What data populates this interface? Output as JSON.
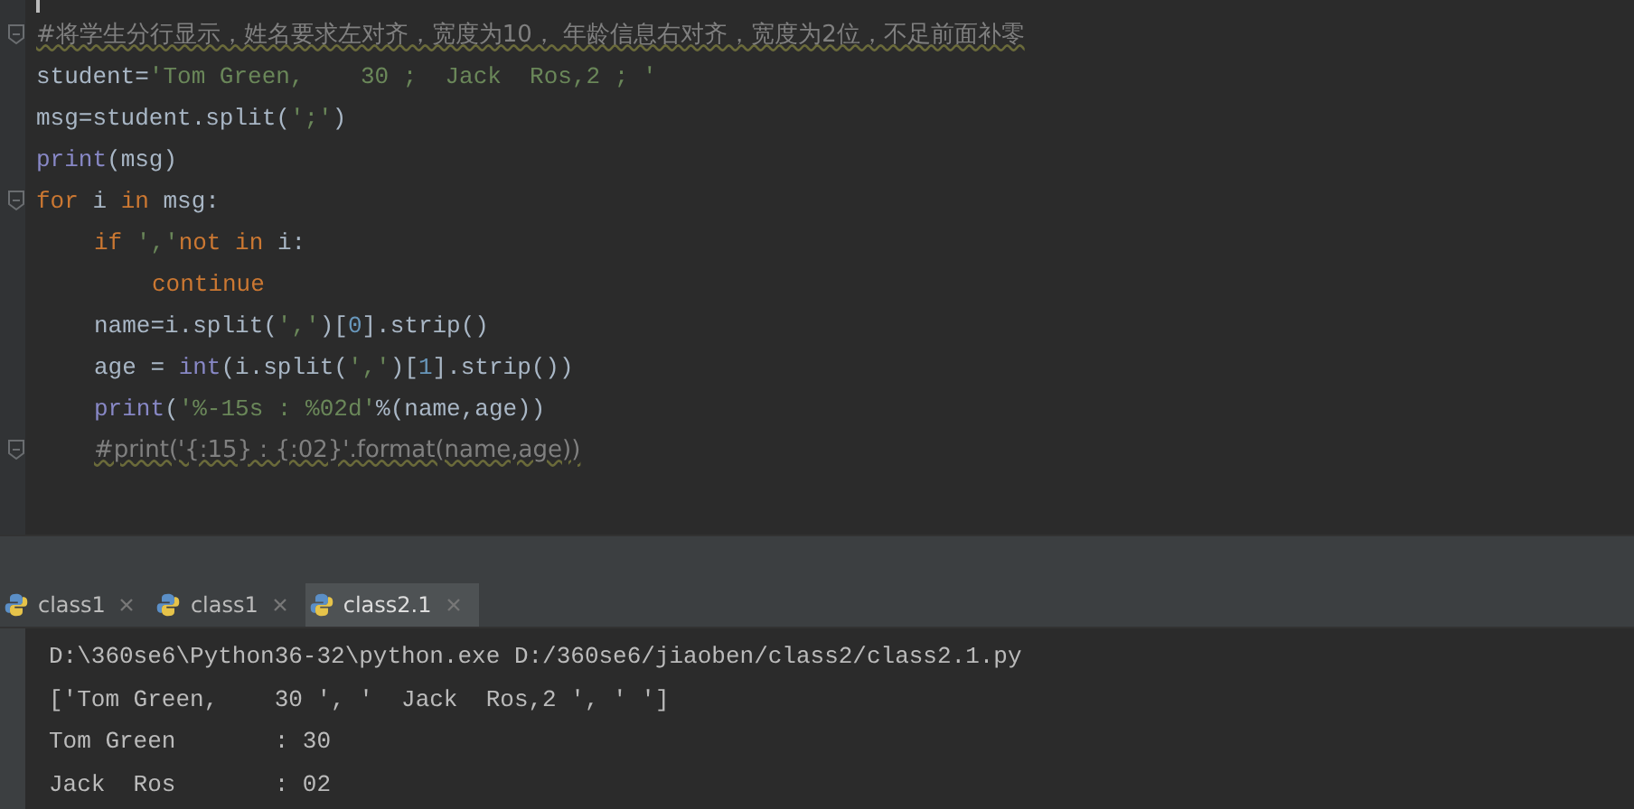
{
  "editor": {
    "lines": [
      {
        "fold_marker": true,
        "tokens": [
          {
            "kind": "comment",
            "text": "#将学生分行显示，姓名要求左对齐，宽度为10， 年龄信息右对齐，宽度为2位，不足前面补零"
          }
        ]
      },
      {
        "fold_marker": false,
        "tokens": [
          {
            "kind": "plain",
            "text": "student="
          },
          {
            "kind": "string",
            "text": "'Tom Green,    30 ;  Jack  Ros,2 ; '"
          }
        ]
      },
      {
        "fold_marker": false,
        "tokens": [
          {
            "kind": "plain",
            "text": "msg=student.split("
          },
          {
            "kind": "string",
            "text": "';'"
          },
          {
            "kind": "plain",
            "text": ")"
          }
        ]
      },
      {
        "fold_marker": false,
        "tokens": [
          {
            "kind": "builtin",
            "text": "print"
          },
          {
            "kind": "plain",
            "text": "(msg)"
          }
        ]
      },
      {
        "fold_marker": true,
        "tokens": [
          {
            "kind": "keyword",
            "text": "for"
          },
          {
            "kind": "plain",
            "text": " i "
          },
          {
            "kind": "keyword",
            "text": "in"
          },
          {
            "kind": "plain",
            "text": " msg:"
          }
        ],
        "children": [
          {
            "fold_marker": false,
            "tokens": [
              {
                "kind": "keyword",
                "text": "if"
              },
              {
                "kind": "string",
                "text": " ','"
              },
              {
                "kind": "keyword",
                "text": "not"
              },
              {
                "kind": "keyword",
                "text": " in"
              },
              {
                "kind": "plain",
                "text": " i:"
              }
            ],
            "children": [
              {
                "fold_marker": false,
                "tokens": [
                  {
                    "kind": "keyword",
                    "text": "continue"
                  }
                ]
              }
            ]
          },
          {
            "fold_marker": false,
            "tokens": [
              {
                "kind": "plain",
                "text": "name=i.split("
              },
              {
                "kind": "string",
                "text": "','"
              },
              {
                "kind": "plain",
                "text": ")["
              },
              {
                "kind": "number",
                "text": "0"
              },
              {
                "kind": "plain",
                "text": "].strip()"
              }
            ]
          },
          {
            "fold_marker": false,
            "tokens": [
              {
                "kind": "plain",
                "text": "age = "
              },
              {
                "kind": "builtin",
                "text": "int"
              },
              {
                "kind": "plain",
                "text": "(i.split("
              },
              {
                "kind": "string",
                "text": "','"
              },
              {
                "kind": "plain",
                "text": ")["
              },
              {
                "kind": "number",
                "text": "1"
              },
              {
                "kind": "plain",
                "text": "].strip())"
              }
            ]
          },
          {
            "fold_marker": false,
            "tokens": [
              {
                "kind": "builtin",
                "text": "print"
              },
              {
                "kind": "plain",
                "text": "("
              },
              {
                "kind": "string",
                "text": "'%-15s : %02d'"
              },
              {
                "kind": "plain",
                "text": "%(name,age))"
              }
            ]
          },
          {
            "fold_marker": true,
            "tokens": [
              {
                "kind": "comment",
                "text": "#print('{:15} : {:02}'.format(name,age))"
              }
            ]
          }
        ]
      }
    ]
  },
  "run_tabs": [
    {
      "label": "class1",
      "selected": false
    },
    {
      "label": "class1",
      "selected": false
    },
    {
      "label": "class2.1",
      "selected": true
    }
  ],
  "console": {
    "lines": [
      "D:\\360se6\\Python36-32\\python.exe D:/360se6/jiaoben/class2/class2.1.py",
      "['Tom Green,    30 ', '  Jack  Ros,2 ', ' ']",
      "Tom Green       : 30",
      "Jack  Ros       : 02"
    ]
  }
}
